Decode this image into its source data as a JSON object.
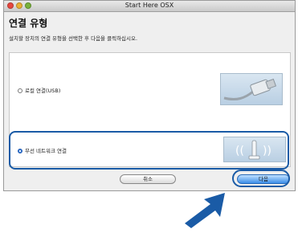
{
  "window": {
    "title": "Start Here OSX"
  },
  "heading": "연결 유형",
  "subtitle": "설치할 장치의 연결 유형을 선택한 후 다음을 클릭하십시오.",
  "options": [
    {
      "label": "로컬 연결(USB)",
      "selected": false,
      "icon": "usb-cable-icon"
    },
    {
      "label": "무선 네트워크 연결",
      "selected": true,
      "icon": "wireless-signal-icon"
    }
  ],
  "buttons": {
    "cancel": "취소",
    "next": "다음"
  },
  "colors": {
    "highlight": "#1a5ba6",
    "next_button": "#3d8ee8"
  }
}
